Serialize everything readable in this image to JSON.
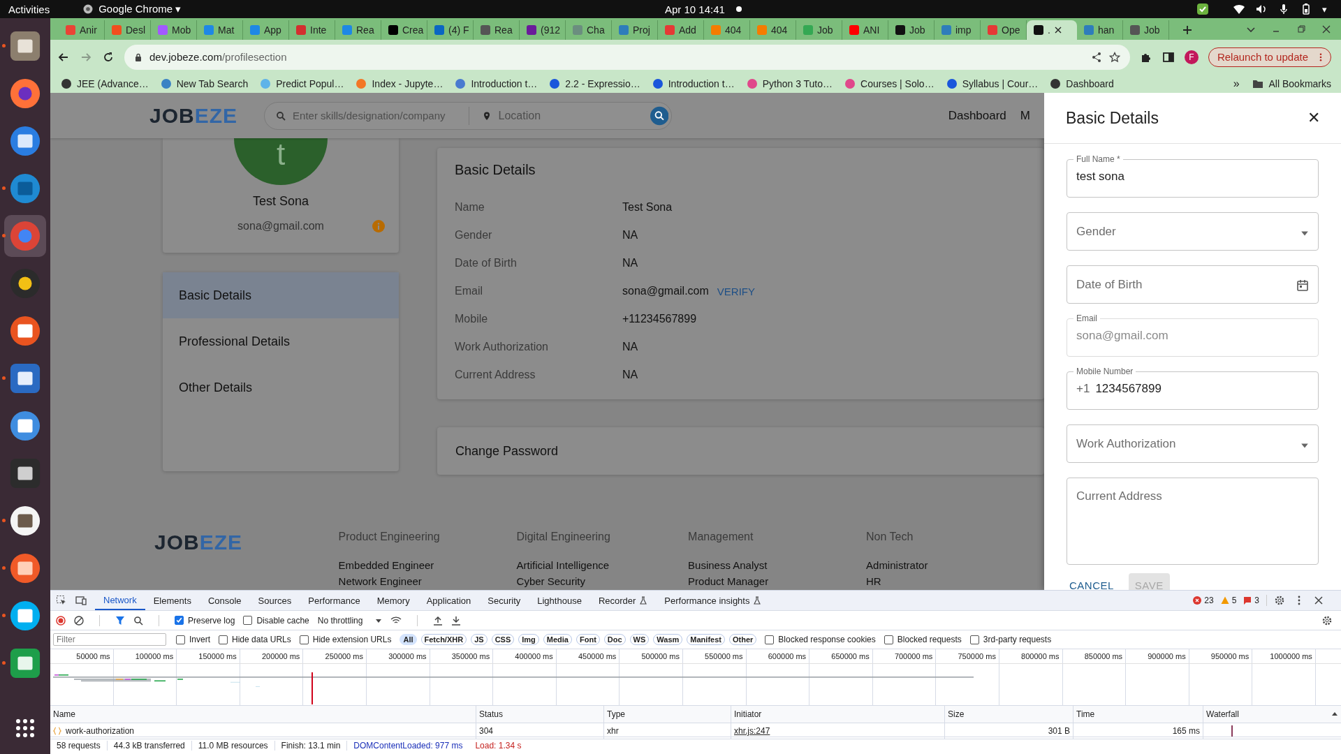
{
  "top_bar": {
    "activities": "Activities",
    "app_name": "Google Chrome",
    "app_caret": "▾",
    "clock": "Apr 10 14:41",
    "system_caret": "▾"
  },
  "dock": [
    {
      "kind": "files",
      "running": true,
      "selected": false
    },
    {
      "kind": "firefox",
      "running": false,
      "selected": false
    },
    {
      "kind": "mail",
      "running": false,
      "selected": false
    },
    {
      "kind": "code",
      "running": true,
      "selected": false
    },
    {
      "kind": "chrome",
      "running": true,
      "selected": true
    },
    {
      "kind": "music",
      "running": false,
      "selected": false
    },
    {
      "kind": "store",
      "running": false,
      "selected": false
    },
    {
      "kind": "writer",
      "running": true,
      "selected": false
    },
    {
      "kind": "help",
      "running": false,
      "selected": false
    },
    {
      "kind": "terminal",
      "running": false,
      "selected": false
    },
    {
      "kind": "gimp",
      "running": true,
      "selected": false
    },
    {
      "kind": "pen",
      "running": true,
      "selected": false
    },
    {
      "kind": "skype",
      "running": true,
      "selected": false
    },
    {
      "kind": "calc",
      "running": true,
      "selected": false
    }
  ],
  "tabs": [
    {
      "title": "Anir",
      "color": "#ea4335",
      "selected": false
    },
    {
      "title": "Desl",
      "color": "#f24e1e",
      "selected": false
    },
    {
      "title": "Mob",
      "color": "#a259ff",
      "selected": false
    },
    {
      "title": "Mat",
      "color": "#1e88e5",
      "selected": false
    },
    {
      "title": "App",
      "color": "#1e88e5",
      "selected": false
    },
    {
      "title": "Inte",
      "color": "#d32f2f",
      "selected": false
    },
    {
      "title": "Rea",
      "color": "#1e88e5",
      "selected": false
    },
    {
      "title": "Crea",
      "color": "#000000",
      "selected": false
    },
    {
      "title": "(4) F",
      "color": "#0a66c2",
      "selected": false
    },
    {
      "title": "Rea",
      "color": "#555555",
      "selected": false
    },
    {
      "title": "(912",
      "color": "#6a1b9a",
      "selected": false
    },
    {
      "title": "Cha",
      "color": "#6b8e7f",
      "selected": false
    },
    {
      "title": "Proj",
      "color": "#2e7dbb",
      "selected": false
    },
    {
      "title": "Add",
      "color": "#e53935",
      "selected": false
    },
    {
      "title": "404",
      "color": "#f57c00",
      "selected": false
    },
    {
      "title": "404",
      "color": "#f57c00",
      "selected": false
    },
    {
      "title": "Job",
      "color": "#34a853",
      "selected": false
    },
    {
      "title": "ANI",
      "color": "#ff0000",
      "selected": false
    },
    {
      "title": "Job",
      "color": "#111111",
      "selected": false
    },
    {
      "title": "imp",
      "color": "#2e7dbb",
      "selected": false
    },
    {
      "title": "Ope",
      "color": "#e53935",
      "selected": false
    },
    {
      "title": ".",
      "color": "#111111",
      "selected": true
    },
    {
      "title": "han",
      "color": "#2e7dbb",
      "selected": false
    },
    {
      "title": "Job",
      "color": "#555555",
      "selected": false
    }
  ],
  "address_bar": {
    "host": "dev.jobeze.com",
    "path": "/profilesection",
    "profile_initial": "F",
    "relaunch": "Relaunch to update"
  },
  "bookmarks": [
    {
      "title": "JEE (Advance…",
      "color": "#333333"
    },
    {
      "title": "New Tab Search",
      "color": "#3b82c4"
    },
    {
      "title": "Predict Popul…",
      "color": "#5fb3e8"
    },
    {
      "title": "Index - Jupyte…",
      "color": "#f37726"
    },
    {
      "title": "Introduction t…",
      "color": "#4a7bd0"
    },
    {
      "title": "2.2 - Expressio…",
      "color": "#1a56db"
    },
    {
      "title": "Introduction t…",
      "color": "#1a56db"
    },
    {
      "title": "Python 3 Tuto…",
      "color": "#e0488b"
    },
    {
      "title": "Courses | Solo…",
      "color": "#e0488b"
    },
    {
      "title": "Syllabus | Cour…",
      "color": "#1a56db"
    },
    {
      "title": "Dashboard",
      "color": "#333333"
    }
  ],
  "bookmarks_overflow": "»",
  "all_bookmarks": "All Bookmarks",
  "site": {
    "logo": {
      "dark": "JOB",
      "accent": "EZE"
    },
    "search_placeholder": "Enter skills/designation/company",
    "location_placeholder": "Location",
    "nav": [
      "Dashboard",
      "M"
    ],
    "profile": {
      "initial": "t",
      "name": "Test Sona",
      "email": "sona@gmail.com"
    },
    "menu": [
      {
        "label": "Basic Details",
        "selected": true
      },
      {
        "label": "Professional Details",
        "selected": false
      },
      {
        "label": "Other Details",
        "selected": false
      }
    ],
    "details": {
      "title": "Basic Details",
      "rows": [
        {
          "label": "Name",
          "value": "Test Sona"
        },
        {
          "label": "Gender",
          "value": "NA"
        },
        {
          "label": "Date of Birth",
          "value": "NA"
        },
        {
          "label": "Email",
          "value": "sona@gmail.com",
          "action": "VERIFY"
        },
        {
          "label": "Mobile",
          "value": "+11234567899"
        },
        {
          "label": "Work Authorization",
          "value": "NA"
        },
        {
          "label": "Current Address",
          "value": "NA"
        }
      ]
    },
    "change_password": "Change Password",
    "footer": {
      "logo": {
        "dark": "JOB",
        "accent": "EZE"
      },
      "columns": [
        {
          "heading": "Product Engineering",
          "items": [
            "Embedded Engineer",
            "Network Engineer"
          ]
        },
        {
          "heading": "Digital Engineering",
          "items": [
            "Artificial Intelligence",
            "Cyber Security"
          ]
        },
        {
          "heading": "Management",
          "items": [
            "Business Analyst",
            "Product Manager"
          ]
        },
        {
          "heading": "Non Tech",
          "items": [
            "Administrator",
            "HR"
          ]
        }
      ]
    }
  },
  "drawer": {
    "title": "Basic Details",
    "close": "✕",
    "fields": [
      {
        "kind": "text",
        "label": "Full Name *",
        "value": "test sona",
        "disabled": false
      },
      {
        "kind": "select",
        "label": "Gender",
        "disabled": false
      },
      {
        "kind": "date",
        "label": "Date of Birth",
        "disabled": false
      },
      {
        "kind": "text",
        "label": "Email",
        "value": "sona@gmail.com",
        "disabled": true
      },
      {
        "kind": "phone",
        "label": "Mobile Number",
        "prefix": "+1",
        "value": "1234567899",
        "disabled": false
      },
      {
        "kind": "select",
        "label": "Work Authorization",
        "disabled": false
      },
      {
        "kind": "textarea",
        "label": "Current Address",
        "disabled": false
      }
    ],
    "buttons": [
      {
        "label": "CANCEL",
        "disabled": false
      },
      {
        "label": "SAVE",
        "disabled": true
      }
    ]
  },
  "devtools": {
    "tabs": [
      {
        "label": "Network",
        "selected": true,
        "experimental": false
      },
      {
        "label": "Elements",
        "selected": false,
        "experimental": false
      },
      {
        "label": "Console",
        "selected": false,
        "experimental": false
      },
      {
        "label": "Sources",
        "selected": false,
        "experimental": false
      },
      {
        "label": "Performance",
        "selected": false,
        "experimental": false
      },
      {
        "label": "Memory",
        "selected": false,
        "experimental": false
      },
      {
        "label": "Application",
        "selected": false,
        "experimental": false
      },
      {
        "label": "Security",
        "selected": false,
        "experimental": false
      },
      {
        "label": "Lighthouse",
        "selected": false,
        "experimental": false
      },
      {
        "label": "Recorder",
        "selected": false,
        "experimental": true
      },
      {
        "label": "Performance insights",
        "selected": false,
        "experimental": true
      }
    ],
    "counts": {
      "errors": "23",
      "warnings": "5",
      "issues": "3"
    },
    "toolbar_checks": [
      {
        "label": "Preserve log",
        "checked": true
      },
      {
        "label": "Disable cache",
        "checked": false
      }
    ],
    "throttling": "No throttling",
    "filter_placeholder": "Filter",
    "filter_checks": [
      {
        "label": "Invert",
        "checked": false
      },
      {
        "label": "Hide data URLs",
        "checked": false
      },
      {
        "label": "Hide extension URLs",
        "checked": false
      }
    ],
    "types": [
      {
        "label": "All",
        "selected": true
      },
      {
        "label": "Fetch/XHR",
        "selected": false
      },
      {
        "label": "JS",
        "selected": false
      },
      {
        "label": "CSS",
        "selected": false
      },
      {
        "label": "Img",
        "selected": false
      },
      {
        "label": "Media",
        "selected": false
      },
      {
        "label": "Font",
        "selected": false
      },
      {
        "label": "Doc",
        "selected": false
      },
      {
        "label": "WS",
        "selected": false
      },
      {
        "label": "Wasm",
        "selected": false
      },
      {
        "label": "Manifest",
        "selected": false
      },
      {
        "label": "Other",
        "selected": false
      }
    ],
    "extra_checks": [
      {
        "label": "Blocked response cookies",
        "checked": false
      },
      {
        "label": "Blocked requests",
        "checked": false
      },
      {
        "label": "3rd-party requests",
        "checked": false
      }
    ],
    "ticks": [
      "50000 ms",
      "100000 ms",
      "150000 ms",
      "200000 ms",
      "250000 ms",
      "300000 ms",
      "350000 ms",
      "400000 ms",
      "450000 ms",
      "500000 ms",
      "550000 ms",
      "600000 ms",
      "650000 ms",
      "700000 ms",
      "750000 ms",
      "800000 ms",
      "850000 ms",
      "900000 ms",
      "950000 ms",
      "1000000 ms"
    ],
    "columns": [
      "Name",
      "Status",
      "Type",
      "Initiator",
      "Size",
      "Time",
      "Waterfall"
    ],
    "rows": [
      {
        "name": "work-authorization",
        "status": "304",
        "type": "xhr",
        "initiator": "xhr.js:247",
        "size": "301 B",
        "time": "165 ms"
      }
    ],
    "summary": [
      {
        "kind": "plain",
        "text": "58 requests"
      },
      {
        "kind": "plain",
        "text": "44.3 kB transferred"
      },
      {
        "kind": "plain",
        "text": "11.0 MB resources"
      },
      {
        "kind": "plain",
        "text": "Finish: 13.1 min"
      },
      {
        "kind": "dom",
        "text": "DOMContentLoaded: 977 ms"
      },
      {
        "kind": "load",
        "text": "Load: 1.34 s"
      }
    ]
  }
}
